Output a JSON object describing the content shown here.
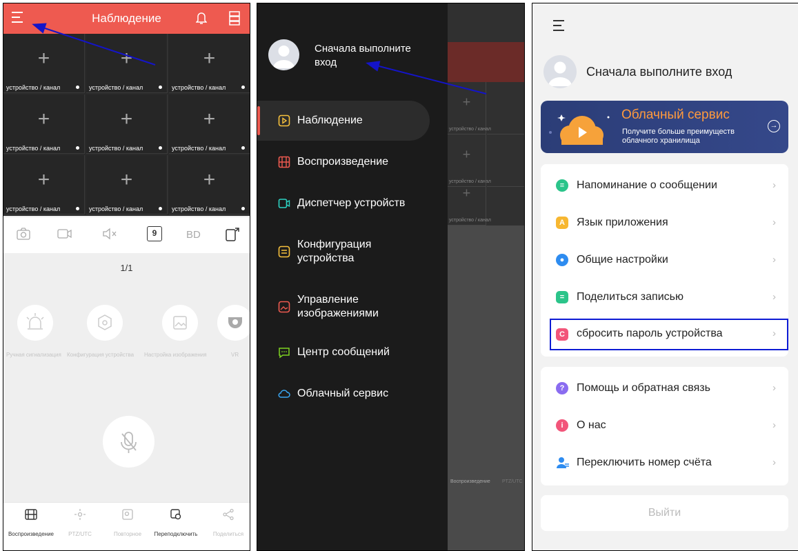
{
  "panel1": {
    "header_title": "Наблюдение",
    "cells": [
      "устройство / канал",
      "устройство / канал",
      "устройство / канал",
      "устройство / канал",
      "устройство / канал",
      "устройство / канал",
      "устройство / канал",
      "устройство / канал",
      "устройство / канал"
    ],
    "toolbar": {
      "split_count": "9",
      "quality": "BD"
    },
    "page_indicator": "1/1",
    "functions": [
      "Ручная сигнализация",
      "Конфигурация устройства",
      "Настройка изображения",
      "VR"
    ],
    "bottom": [
      "Воспроизведение",
      "PTZ/UTC",
      "Повторное",
      "Переподключить",
      "Поделиться"
    ],
    "accent_color": "#ee5a50"
  },
  "panel2": {
    "login_text": "Сначала выполните вход",
    "menu": [
      {
        "label": "Наблюдение",
        "icon": "monitor-icon",
        "active": true
      },
      {
        "label": "Воспроизведение",
        "icon": "film-icon"
      },
      {
        "label": "Диспетчер устройств",
        "icon": "camera-icon"
      },
      {
        "label": "Конфигурация устройства",
        "icon": "settings-box-icon"
      },
      {
        "label": "Управление изображениями",
        "icon": "image-icon"
      },
      {
        "label": "Центр сообщений",
        "icon": "chat-icon"
      },
      {
        "label": "Облачный сервис",
        "icon": "cloud-icon"
      }
    ],
    "bg_cell_label": "устройство / канал",
    "bg_bottom_label": "Воспроизведение",
    "bg_bottom_label2": "PTZ/UTC"
  },
  "panel3": {
    "login_text": "Сначала выполните вход",
    "cloud": {
      "title": "Облачный сервис",
      "subtitle": "Получите больше преимуществ облачного хранилища"
    },
    "group1": [
      {
        "label": "Напоминание о сообщении",
        "icon": "message-icon",
        "color": "#2bc48a"
      },
      {
        "label": "Язык приложения",
        "icon": "language-icon",
        "color": "#f7b731",
        "glyph": "A"
      },
      {
        "label": "Общие настройки",
        "icon": "settings-icon",
        "color": "#2e8cf0"
      },
      {
        "label": "Поделиться записью",
        "icon": "share-record-icon",
        "color": "#2bc48a"
      },
      {
        "label": "сбросить пароль устройства",
        "icon": "lock-icon",
        "color": "#f2557a",
        "glyph": "C"
      }
    ],
    "group2": [
      {
        "label": "Помощь и обратная связь",
        "icon": "help-icon",
        "color": "#8a6cf0",
        "glyph": "?"
      },
      {
        "label": "О нас",
        "icon": "info-icon",
        "color": "#f2557a",
        "glyph": "i"
      },
      {
        "label": "Переключить номер счёта",
        "icon": "switch-account-icon",
        "color": "#2e8cf0"
      }
    ],
    "logout": "Выйти",
    "chevron": "›"
  }
}
